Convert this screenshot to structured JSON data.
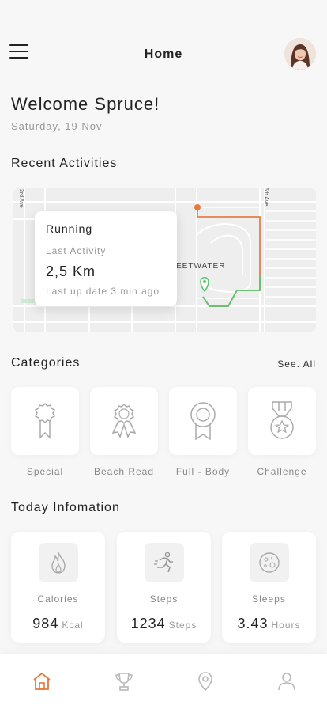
{
  "header": {
    "title": "Home",
    "menu_icon": "menu-icon",
    "avatar_icon": "user-avatar"
  },
  "welcome": {
    "greeting": "Welcome Spruce!",
    "date": "Saturday, 19 Nov"
  },
  "recent_activities": {
    "title": "Recent Activities",
    "map_label": "EETWATER",
    "map_street_left": "3rd Ave",
    "map_street_right": "5th Ave",
    "card": {
      "title": "Running",
      "subtitle": "Last Activity",
      "value": "2,5 Km",
      "updated": "Last up date 3 min ago"
    },
    "route_colors": {
      "start": "#f08a4b",
      "end": "#5cc46e"
    }
  },
  "categories": {
    "title": "Categories",
    "see_all": "See. All",
    "items": [
      {
        "label": "Special",
        "icon": "award-ribbon-icon"
      },
      {
        "label": "Beach Read",
        "icon": "badge-ribbon-icon"
      },
      {
        "label": "Full - Body",
        "icon": "medal-ribbon-icon"
      },
      {
        "label": "Challenge",
        "icon": "star-medal-icon"
      }
    ]
  },
  "today": {
    "title": "Today Infomation",
    "items": [
      {
        "label": "Calories",
        "value": "984",
        "unit": "Kcal",
        "icon": "flame-icon"
      },
      {
        "label": "Steps",
        "value": "1234",
        "unit": "Steps",
        "icon": "runner-icon"
      },
      {
        "label": "Sleeps",
        "value": "3.43",
        "unit": "Hours",
        "icon": "moon-icon"
      }
    ]
  },
  "nav": {
    "items": [
      {
        "icon": "home-icon",
        "active": true
      },
      {
        "icon": "trophy-icon",
        "active": false
      },
      {
        "icon": "location-pin-icon",
        "active": false
      },
      {
        "icon": "profile-icon",
        "active": false
      }
    ],
    "active_color": "#e8793a",
    "inactive_color": "#b8b8b8"
  }
}
